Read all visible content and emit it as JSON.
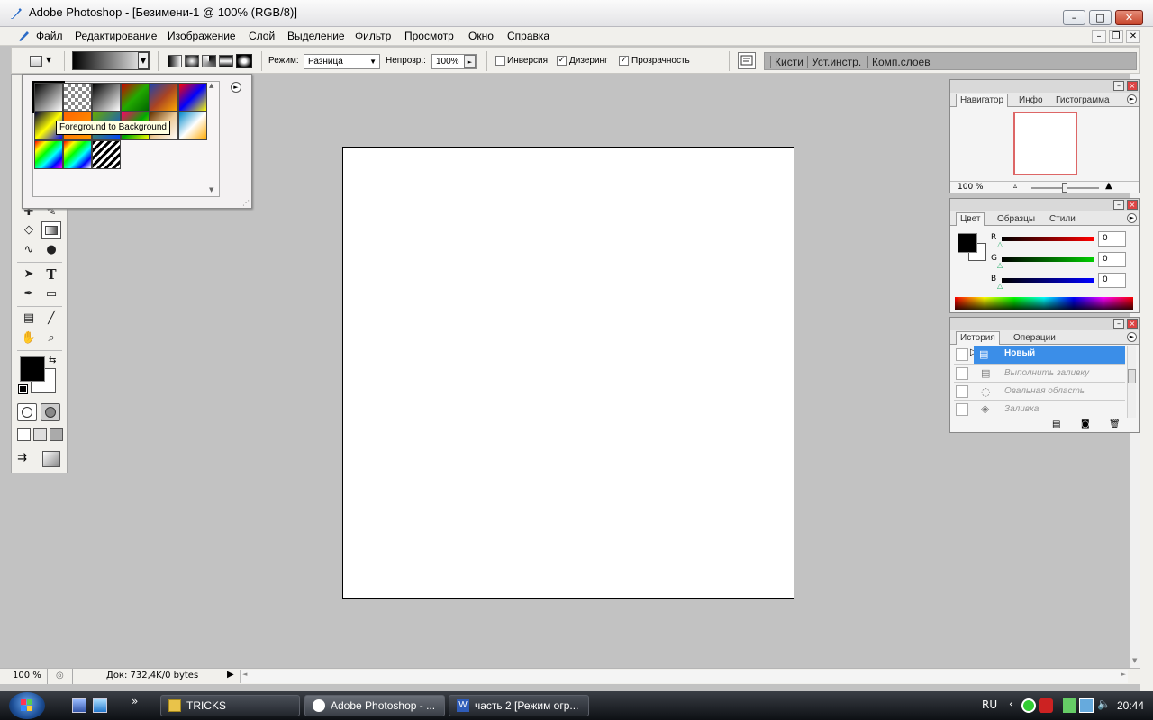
{
  "window": {
    "title": "Adobe Photoshop - [Безимени-1 @ 100% (RGB/8)]",
    "minimize": "–",
    "maximize": "□",
    "close": "✕"
  },
  "menu": [
    "Файл",
    "Редактирование",
    "Изображение",
    "Слой",
    "Выделение",
    "Фильтр",
    "Просмотр",
    "Окно",
    "Справка"
  ],
  "mdi": {
    "minimize": "–",
    "restore": "❐",
    "close": "✕"
  },
  "options": {
    "mode_label": "Режим:",
    "mode_value": "Разница",
    "opacity_label": "Непрозр.:",
    "opacity_value": "100%",
    "reverse_label": "Инверсия",
    "reverse_checked": false,
    "dither_label": "Дизеринг",
    "dither_checked": true,
    "transparency_label": "Прозрачность",
    "transparency_checked": true,
    "check": "✓"
  },
  "palette_well": [
    "Кисти",
    "Уст.инстр.",
    "Комп.слоев"
  ],
  "gradient_picker": {
    "tooltip": "Foreground to Background",
    "menu_icon": "►",
    "swatches": [
      "linear-gradient(135deg,#000,#fff)",
      "repeating-conic-gradient(#888 0% 25%,#fff 0% 50%) 0 0/8px 8px",
      "linear-gradient(135deg,#000,#fff)",
      "linear-gradient(135deg,#c00,#2a0,#060)",
      "linear-gradient(135deg,#24a,#a42,#fa0)",
      "linear-gradient(135deg,#f00,#00f,#ff0)",
      "linear-gradient(135deg,#003,#ff0,#00f)",
      "linear-gradient(135deg,#f60,#f90)",
      "linear-gradient(135deg,#6a0,#04f)",
      "linear-gradient(135deg,#f06,#0a0,#ff0)",
      "linear-gradient(135deg,#630,#ec9,#fff)",
      "linear-gradient(135deg,#08c,#fff,#fa0)",
      "linear-gradient(135deg,#f00,#ff0,#0f0,#0ff,#00f,#f0f)",
      "linear-gradient(135deg,#f00,#ff0,#0f0,#0ff,#00f,#fff)",
      "repeating-linear-gradient(135deg,#000 0 3px,#fff 3px 6px)"
    ]
  },
  "navigator": {
    "tabs": [
      "Навигатор",
      "Инфо",
      "Гистограмма"
    ],
    "zoom": "100 %"
  },
  "color_panel": {
    "tabs": [
      "Цвет",
      "Образцы",
      "Стили"
    ],
    "r_label": "R",
    "g_label": "G",
    "b_label": "B",
    "r": "0",
    "g": "0",
    "b": "0"
  },
  "history": {
    "tabs": [
      "История",
      "Операции"
    ],
    "items": [
      {
        "label": "Новый",
        "selected": true
      },
      {
        "label": "Выполнить заливку",
        "selected": false
      },
      {
        "label": "Овальная область",
        "selected": false
      },
      {
        "label": "Заливка",
        "selected": false
      }
    ]
  },
  "status": {
    "zoom": "100 %",
    "doc_info": "Док: 732,4K/0 bytes"
  },
  "taskbar": {
    "tasks": [
      "TRICKS",
      "Adobe Photoshop - ...",
      "часть 2 [Режим огр..."
    ],
    "lang": "RU",
    "time": "20:44",
    "chevron": "»",
    "tray_arrow": "‹"
  },
  "colors": {
    "foreground": "#000000",
    "background": "#ffffff",
    "history_selected": "#3b8ee8"
  }
}
